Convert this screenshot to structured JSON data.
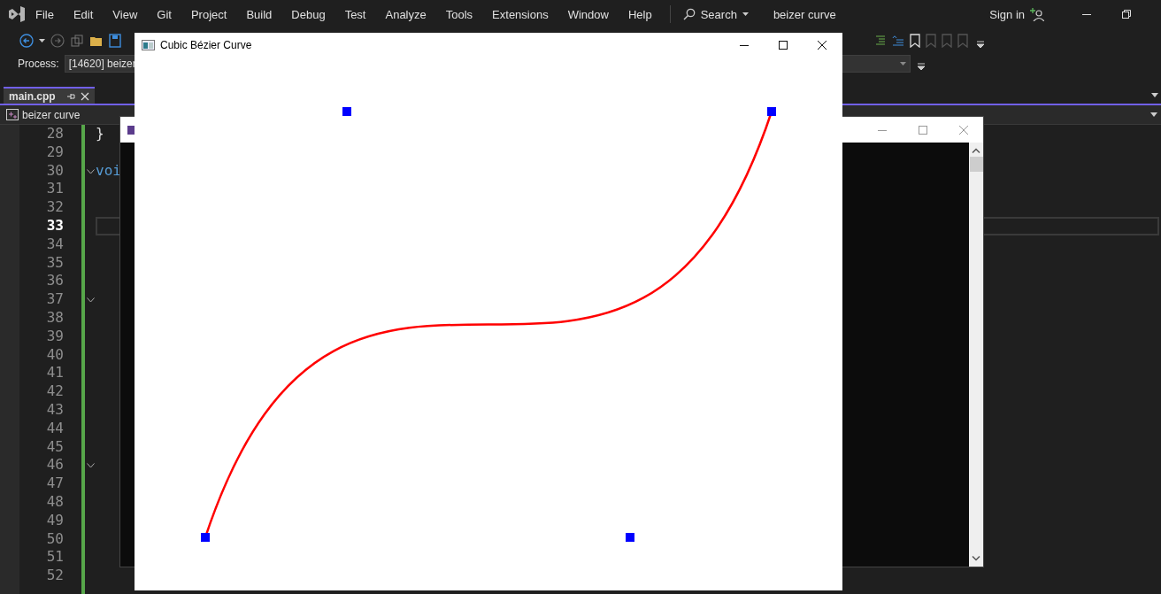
{
  "menu": [
    "File",
    "Edit",
    "View",
    "Git",
    "Project",
    "Build",
    "Debug",
    "Test",
    "Analyze",
    "Tools",
    "Extensions",
    "Window",
    "Help"
  ],
  "search": {
    "label": "Search"
  },
  "solution_name": "beizer curve",
  "sign_in": "Sign in",
  "process": {
    "label": "Process:",
    "value": "[14620] beizer"
  },
  "tabs": [
    {
      "label": "main.cpp",
      "selected": true
    }
  ],
  "navigation": {
    "value": "beizer curve"
  },
  "lines": [
    {
      "number": "28",
      "current": false,
      "foldable": false,
      "code": {
        "text": "}",
        "kind": "plain"
      }
    },
    {
      "number": "29",
      "current": false,
      "foldable": false
    },
    {
      "number": "30",
      "current": false,
      "foldable": true,
      "code": {
        "text": "voi",
        "kind": "keyword"
      }
    },
    {
      "number": "31",
      "current": false,
      "foldable": false
    },
    {
      "number": "32",
      "current": false,
      "foldable": false
    },
    {
      "number": "33",
      "current": true,
      "foldable": false
    },
    {
      "number": "34",
      "current": false,
      "foldable": false
    },
    {
      "number": "35",
      "current": false,
      "foldable": false
    },
    {
      "number": "36",
      "current": false,
      "foldable": false
    },
    {
      "number": "37",
      "current": false,
      "foldable": true
    },
    {
      "number": "38",
      "current": false,
      "foldable": false
    },
    {
      "number": "39",
      "current": false,
      "foldable": false
    },
    {
      "number": "40",
      "current": false,
      "foldable": false
    },
    {
      "number": "41",
      "current": false,
      "foldable": false
    },
    {
      "number": "42",
      "current": false,
      "foldable": false
    },
    {
      "number": "43",
      "current": false,
      "foldable": false
    },
    {
      "number": "44",
      "current": false,
      "foldable": false
    },
    {
      "number": "45",
      "current": false,
      "foldable": false
    },
    {
      "number": "46",
      "current": false,
      "foldable": true
    },
    {
      "number": "47",
      "current": false,
      "foldable": false
    },
    {
      "number": "48",
      "current": false,
      "foldable": false
    },
    {
      "number": "49",
      "current": false,
      "foldable": false
    },
    {
      "number": "50",
      "current": false,
      "foldable": false
    },
    {
      "number": "51",
      "current": false,
      "foldable": false
    },
    {
      "number": "52",
      "current": false,
      "foldable": false
    }
  ],
  "bezier_window": {
    "title": "Cubic Bézier Curve"
  }
}
